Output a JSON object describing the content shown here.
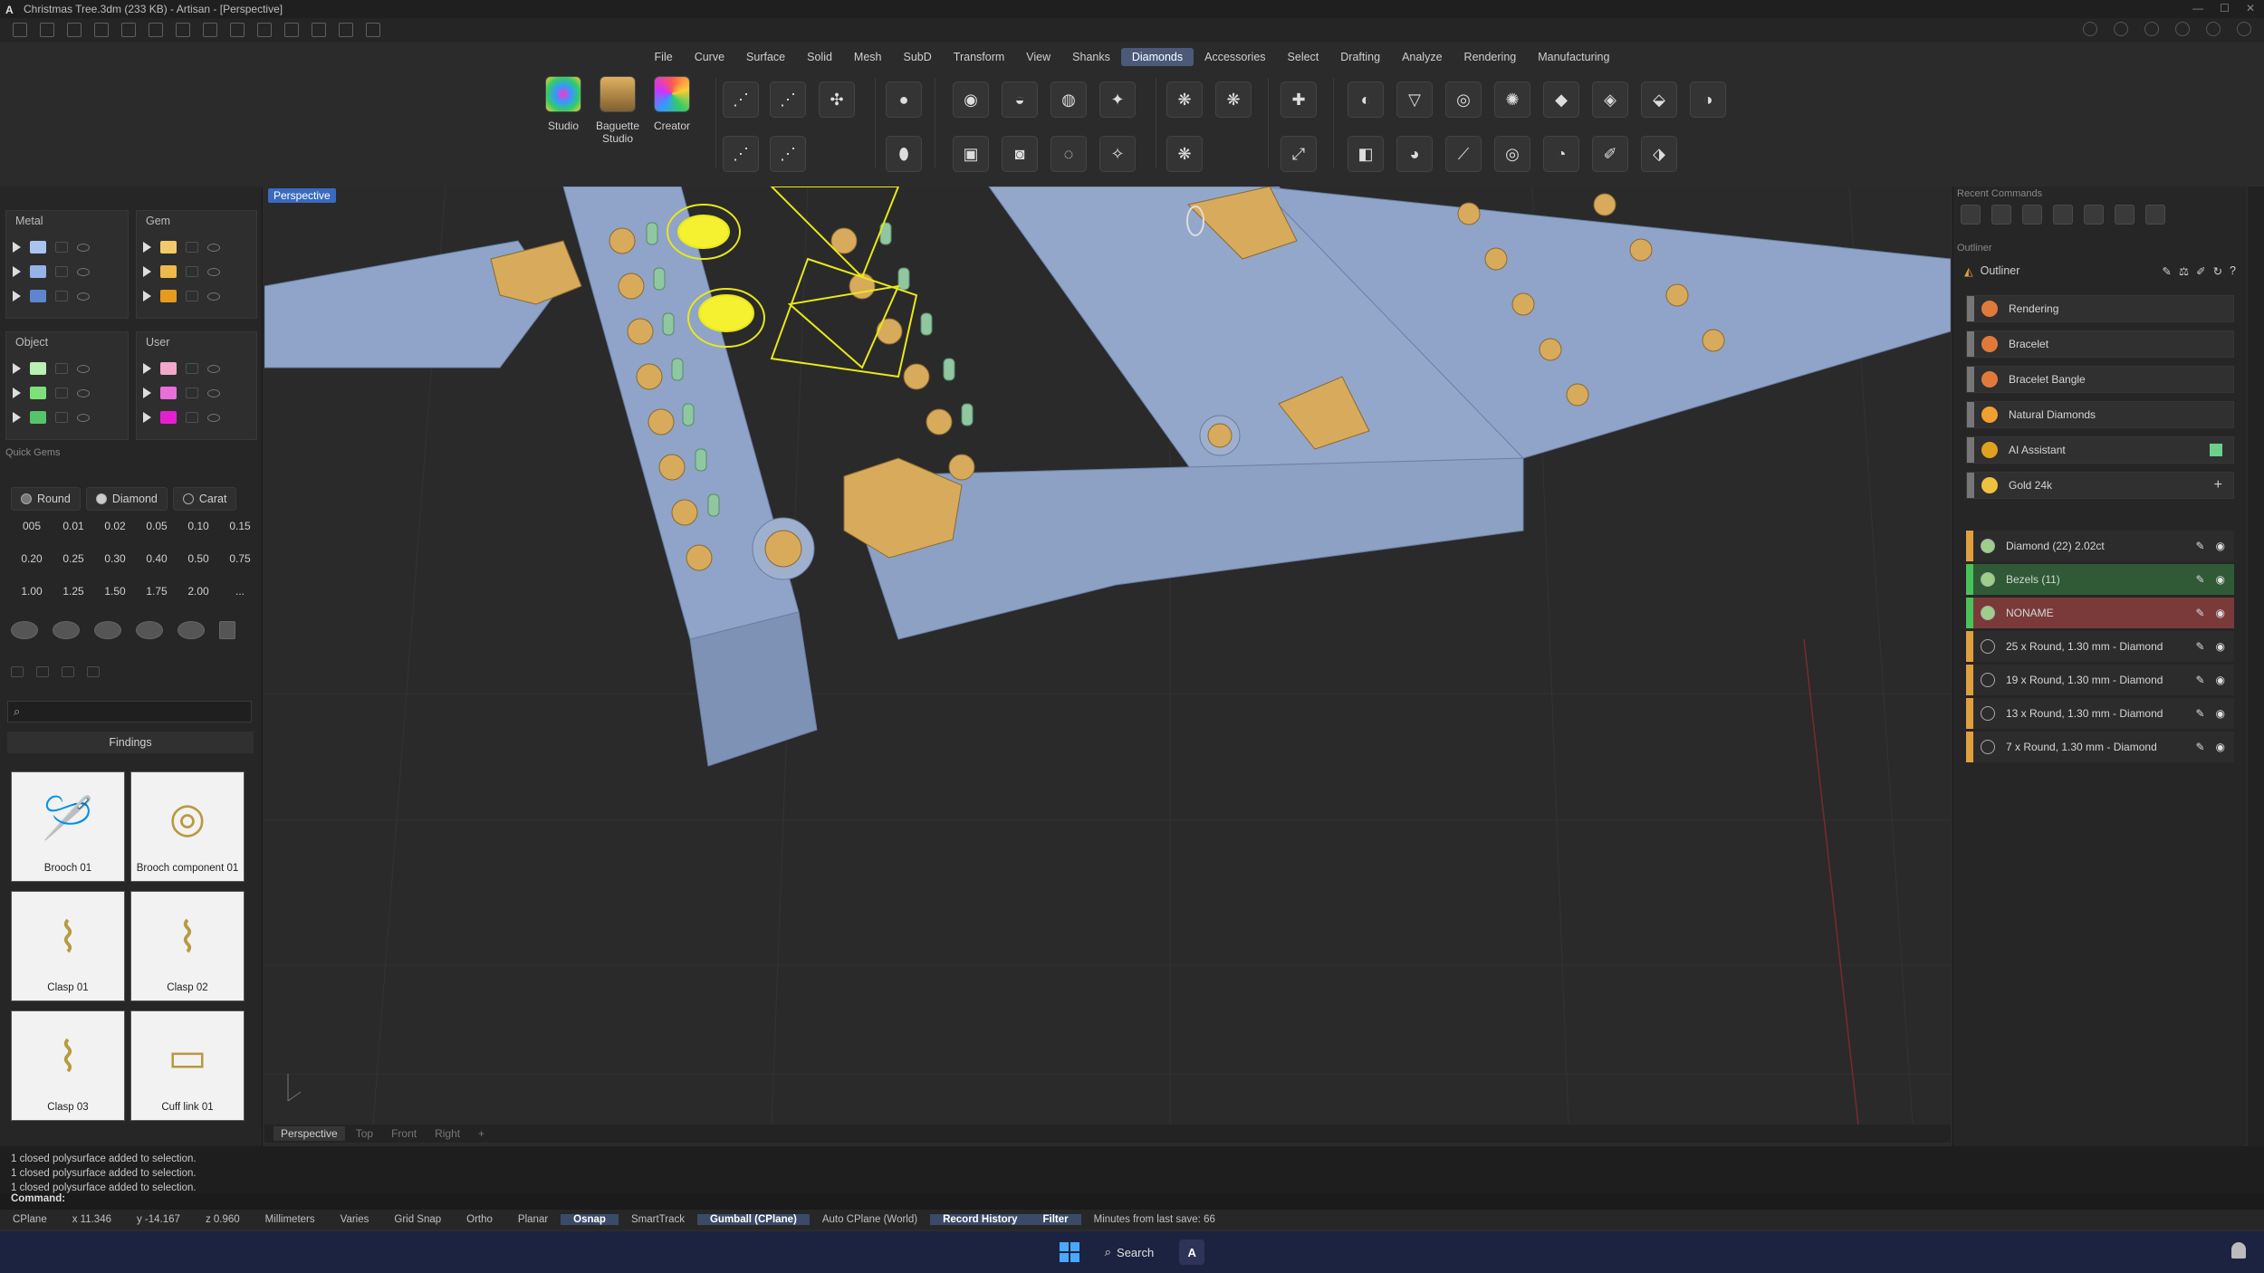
{
  "window": {
    "title": "Christmas Tree.3dm (233 KB) - Artisan - [Perspective]"
  },
  "menu": [
    "File",
    "Curve",
    "Surface",
    "Solid",
    "Mesh",
    "SubD",
    "Transform",
    "View",
    "Shanks",
    "Diamonds",
    "Accessories",
    "Select",
    "Drafting",
    "Analyze",
    "Rendering",
    "Manufacturing"
  ],
  "menu_active": "Diamonds",
  "ribbon": {
    "big_buttons": [
      {
        "label": "Studio",
        "icon": "studio-icon"
      },
      {
        "label": "Baguette Studio",
        "icon": "baguette-studio-icon"
      },
      {
        "label": "Creator",
        "icon": "creator-icon"
      }
    ]
  },
  "left_panel": {
    "metal_title": "Metal",
    "gem_title": "Gem",
    "object_title": "Object",
    "user_title": "User",
    "metal_colors": [
      "#a9c4ef",
      "#94b3e6",
      "#5d86cf"
    ],
    "gem_colors": [
      "#f2c96b",
      "#f0b84a",
      "#e79a1c"
    ],
    "object_colors": [
      "#b9f0b3",
      "#7ee07a",
      "#55c46a"
    ],
    "user_colors": [
      "#f2a8c8",
      "#ea6ed8",
      "#e41fd0"
    ],
    "quick_gems_title": "Quick Gems",
    "tabs": [
      "Round",
      "Diamond",
      "Carat"
    ],
    "sizes": [
      "005",
      "0.01",
      "0.02",
      "0.05",
      "0.10",
      "0.15",
      "0.20",
      "0.25",
      "0.30",
      "0.40",
      "0.50",
      "0.75",
      "1.00",
      "1.25",
      "1.50",
      "1.75",
      "2.00",
      "..."
    ],
    "findings_title": "Findings",
    "findings": [
      "Brooch 01",
      "Brooch component 01",
      "Clasp 01",
      "Clasp 02",
      "Clasp 03",
      "Cuff link 01"
    ]
  },
  "viewport": {
    "label": "Perspective",
    "tabs": [
      "Perspective",
      "Top",
      "Front",
      "Right"
    ]
  },
  "right_panel": {
    "recent_commands_title": "Recent Commands",
    "outliner_title": "Outliner",
    "outliner_header": "Outliner",
    "groups": [
      {
        "name": "Rendering",
        "color": "#e07a3a"
      },
      {
        "name": "Bracelet",
        "color": "#e07a3a"
      },
      {
        "name": "Bracelet Bangle",
        "color": "#e07a3a"
      },
      {
        "name": "Natural Diamonds",
        "color": "#f0a030"
      },
      {
        "name": "AI Assistant",
        "color": "#e0a020"
      },
      {
        "name": "Gold 24k",
        "color": "#f0c040"
      }
    ],
    "layers": [
      {
        "name": "Diamond (22) 2.02ct",
        "bar": "#e0a040",
        "bg": "#2c2c2c"
      },
      {
        "name": "Bezels (11)",
        "bar": "#49c25a",
        "bg": "#2f5a35"
      },
      {
        "name": "NONAME",
        "bar": "#49c25a",
        "bg": "#7a3a3a"
      },
      {
        "name": "25 x Round, 1.30 mm - Diamond",
        "bar": "#e0a040",
        "bg": "#2c2c2c"
      },
      {
        "name": "19 x Round, 1.30 mm - Diamond",
        "bar": "#e0a040",
        "bg": "#2c2c2c"
      },
      {
        "name": "13 x Round, 1.30 mm - Diamond",
        "bar": "#e0a040",
        "bg": "#2c2c2c"
      },
      {
        "name": "7 x Round, 1.30 mm - Diamond",
        "bar": "#e0a040",
        "bg": "#2c2c2c"
      }
    ]
  },
  "command": {
    "history": [
      "1 closed polysurface added to selection.",
      "1 closed polysurface added to selection.",
      "1 closed polysurface added to selection."
    ],
    "prompt": "Command:"
  },
  "status": {
    "cplane": "CPlane",
    "x": "x 11.346",
    "y": "y -14.167",
    "z": "z 0.960",
    "units": "Millimeters",
    "layer": "Varies",
    "grid_snap": "Grid Snap",
    "ortho": "Ortho",
    "planar": "Planar",
    "osnap": "Osnap",
    "smarttrack": "SmartTrack",
    "gumball": "Gumball (CPlane)",
    "auto_cplane": "Auto CPlane (World)",
    "record_history": "Record History",
    "filter": "Filter",
    "minutes": "Minutes from last save: 66"
  },
  "taskbar": {
    "search": "Search"
  }
}
